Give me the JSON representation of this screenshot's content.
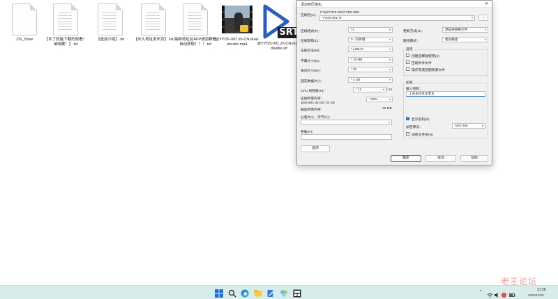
{
  "desktop": {
    "files": [
      {
        "name": ".DS_Store"
      },
      {
        "name": "【本了就能下载的权看！请收藏！】.txt"
      },
      {
        "name": "【追加介绍】.txt"
      },
      {
        "name": "【永久地址发布页】.txt"
      },
      {
        "name": "最新地址及APP请加群看自动获取！！！.txt"
      },
      {
        "name": "@YYDS-001.zh-CN-dual-double.mp4"
      },
      {
        "name": "@YYDS-001.zh-CN-dual-double.srt"
      }
    ],
    "srt_label": "SRT"
  },
  "dialog": {
    "title": "添加到压缩包",
    "close_glyph": "✕",
    "archive_label": "压缩包(A)：",
    "archive_path": "F:\\sp\\YYDS-002\\YYDS-001\\",
    "archive_name": "YYDS-001.7z",
    "browse_label": "...",
    "left": {
      "format_label": "压缩格式(F)：",
      "format_value": "7z",
      "level_label": "压缩等级(L)：",
      "level_value": "0 - 仅存储",
      "method_label": "压缩方法(M)：",
      "method_value": "* LZMA2",
      "dict_label": "字典大小(D)：",
      "dict_value": "* 16 MB",
      "word_label": "单词大小(W)：",
      "word_value": "* 32",
      "solid_label": "固实数据大小：",
      "solid_value": "* 4 GB",
      "cpu_label": "CPU 线程数(H)：",
      "cpu_value": "* 12",
      "cpu_max": "/ 12",
      "mem_compress_label": "压缩所需内存：",
      "mem_detail": "1848 MB / 26 GB / 32 GB",
      "mem_percent": "* 80%",
      "mem_decompress_label": "解压所需内存：",
      "mem_decompress_value": "16 MB",
      "split_label": "分卷大小，字节(V)：",
      "split_value": "",
      "params_label": "参数(P)：",
      "params_value": "",
      "options_button": "选项"
    },
    "right": {
      "update_label": "更新方式(U)：",
      "update_value": "添加并替换文件",
      "path_label": "路径模式：",
      "path_value": "相对路径",
      "options_title": "选项",
      "opt_sfx": "创建自释放程序(X)",
      "opt_shared": "压缩共享文件",
      "opt_delete": "操作完成后删除源文件",
      "encryption_title": "加密",
      "password_label": "输入密码：",
      "password_value": "上古王社社论老王",
      "show_password": "显示密码(S)",
      "method_label": "加密算法：",
      "method_value": "AES-256",
      "encrypt_names": "加密文件名(N)"
    },
    "buttons": {
      "ok": "确定",
      "cancel": "取消",
      "help": "帮助"
    }
  },
  "taskbar": {
    "tray_chevron": "^",
    "time": "21:58",
    "date": "2024/11/26"
  },
  "watermark": "老王论坛"
}
